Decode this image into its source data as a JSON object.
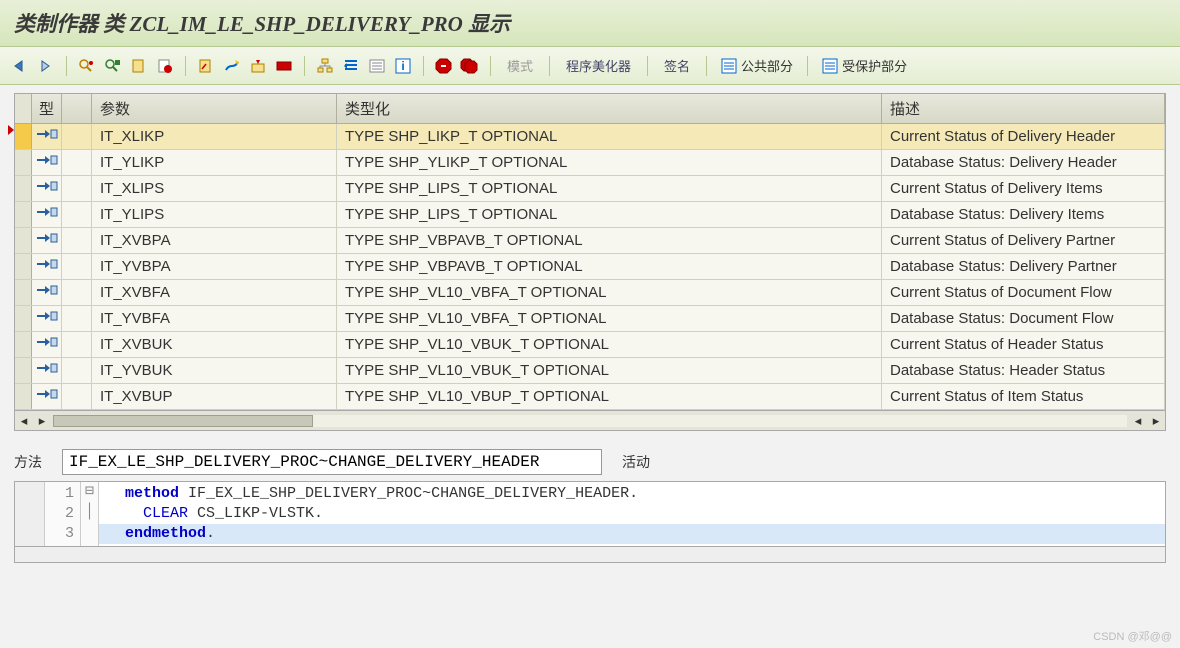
{
  "title": "类制作器 类 ZCL_IM_LE_SHP_DELIVERY_PRO 显示",
  "toolbar": {
    "mode": "模式",
    "beautify": "程序美化器",
    "signature": "签名",
    "public": "公共部分",
    "protected": "受保护部分"
  },
  "headers": {
    "type": "型",
    "param": "参数",
    "typing": "类型化",
    "desc": "描述"
  },
  "rows": [
    {
      "param": "IT_XLIKP",
      "typing": "TYPE SHP_LIKP_T OPTIONAL",
      "desc": "Current Status of Delivery Header",
      "selected": true
    },
    {
      "param": "IT_YLIKP",
      "typing": "TYPE SHP_YLIKP_T OPTIONAL",
      "desc": "Database Status: Delivery Header"
    },
    {
      "param": "IT_XLIPS",
      "typing": "TYPE SHP_LIPS_T OPTIONAL",
      "desc": "Current Status of Delivery Items"
    },
    {
      "param": "IT_YLIPS",
      "typing": "TYPE SHP_LIPS_T OPTIONAL",
      "desc": "Database Status: Delivery Items"
    },
    {
      "param": "IT_XVBPA",
      "typing": "TYPE SHP_VBPAVB_T OPTIONAL",
      "desc": "Current Status of Delivery Partner"
    },
    {
      "param": "IT_YVBPA",
      "typing": "TYPE SHP_VBPAVB_T OPTIONAL",
      "desc": "Database Status: Delivery Partner"
    },
    {
      "param": "IT_XVBFA",
      "typing": "TYPE SHP_VL10_VBFA_T OPTIONAL",
      "desc": "Current Status of Document Flow"
    },
    {
      "param": "IT_YVBFA",
      "typing": "TYPE SHP_VL10_VBFA_T OPTIONAL",
      "desc": "Database Status: Document Flow"
    },
    {
      "param": "IT_XVBUK",
      "typing": "TYPE SHP_VL10_VBUK_T OPTIONAL",
      "desc": "Current Status of Header Status"
    },
    {
      "param": "IT_YVBUK",
      "typing": "TYPE SHP_VL10_VBUK_T OPTIONAL",
      "desc": "Database Status: Header Status"
    },
    {
      "param": "IT_XVBUP",
      "typing": "TYPE SHP_VL10_VBUP_T OPTIONAL",
      "desc": "Current Status of Item Status"
    }
  ],
  "method": {
    "label": "方法",
    "value": "IF_EX_LE_SHP_DELIVERY_PROC~CHANGE_DELIVERY_HEADER",
    "status": "活动"
  },
  "code": {
    "lines": [
      {
        "n": "1",
        "fold": "⊟",
        "html": "  <span class='kw'>method</span> IF_EX_LE_SHP_DELIVERY_PROC~CHANGE_DELIVERY_HEADER."
      },
      {
        "n": "2",
        "fold": "│",
        "html": "    <span class='kw2'>CLEAR</span> CS_LIKP-VLSTK."
      },
      {
        "n": "3",
        "fold": "",
        "html": "  <span class='kw'>endmethod</span>.",
        "current": true
      }
    ]
  },
  "watermark": "CSDN @邓@@"
}
